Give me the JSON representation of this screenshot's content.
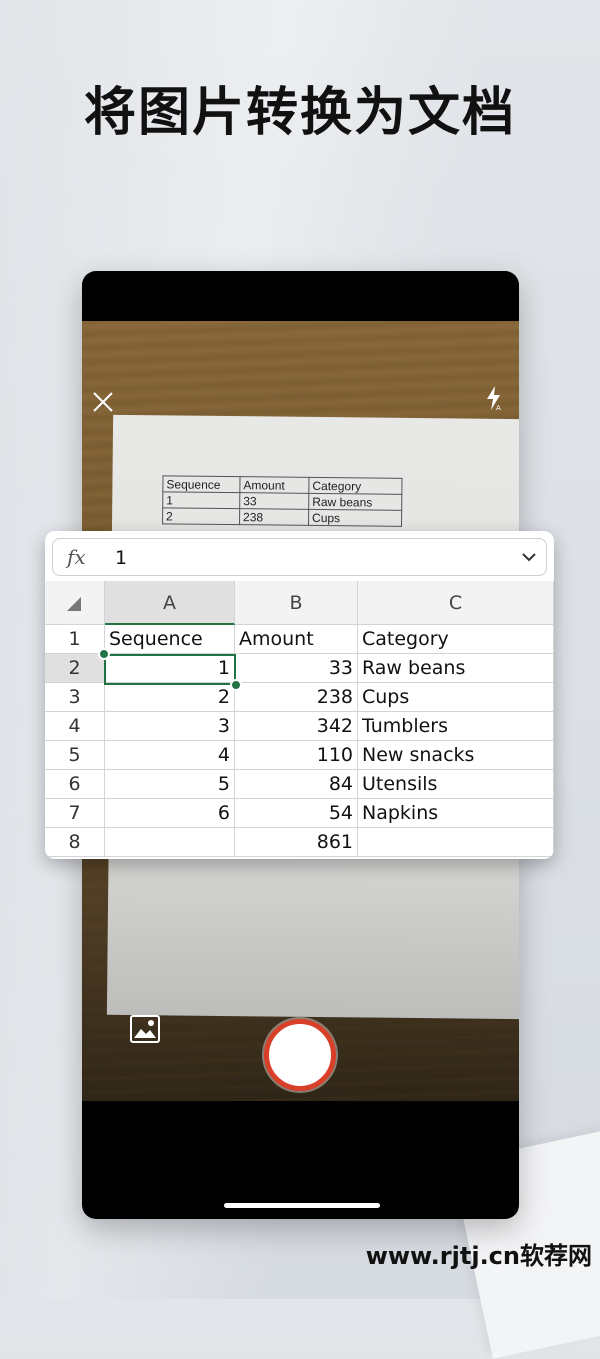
{
  "headline": "将图片转换为文档",
  "camera": {
    "close_icon": "close-icon",
    "flash_icon": "flash-auto-icon",
    "gallery_icon": "image-gallery-icon",
    "shutter_color": "#d8402a",
    "document_table": {
      "headers": [
        "Sequence",
        "Amount",
        "Category"
      ],
      "rows": [
        [
          "1",
          "33",
          "Raw beans"
        ],
        [
          "2",
          "238",
          "Cups"
        ]
      ]
    }
  },
  "formula_bar": {
    "fx_label": "fx",
    "value": "1"
  },
  "spreadsheet": {
    "selected_cell": "A2",
    "accent_color": "#217346",
    "columns": [
      "A",
      "B",
      "C"
    ],
    "row_numbers": [
      "1",
      "2",
      "3",
      "4",
      "5",
      "6",
      "7",
      "8"
    ],
    "rows": [
      [
        "Sequence",
        "Amount",
        "Category"
      ],
      [
        "1",
        "33",
        "Raw beans"
      ],
      [
        "2",
        "238",
        "Cups"
      ],
      [
        "3",
        "342",
        "Tumblers"
      ],
      [
        "4",
        "110",
        "New snacks"
      ],
      [
        "5",
        "84",
        "Utensils"
      ],
      [
        "6",
        "54",
        "Napkins"
      ],
      [
        "",
        "861",
        ""
      ]
    ]
  },
  "watermark": "www.rjtj.cn软荐网"
}
